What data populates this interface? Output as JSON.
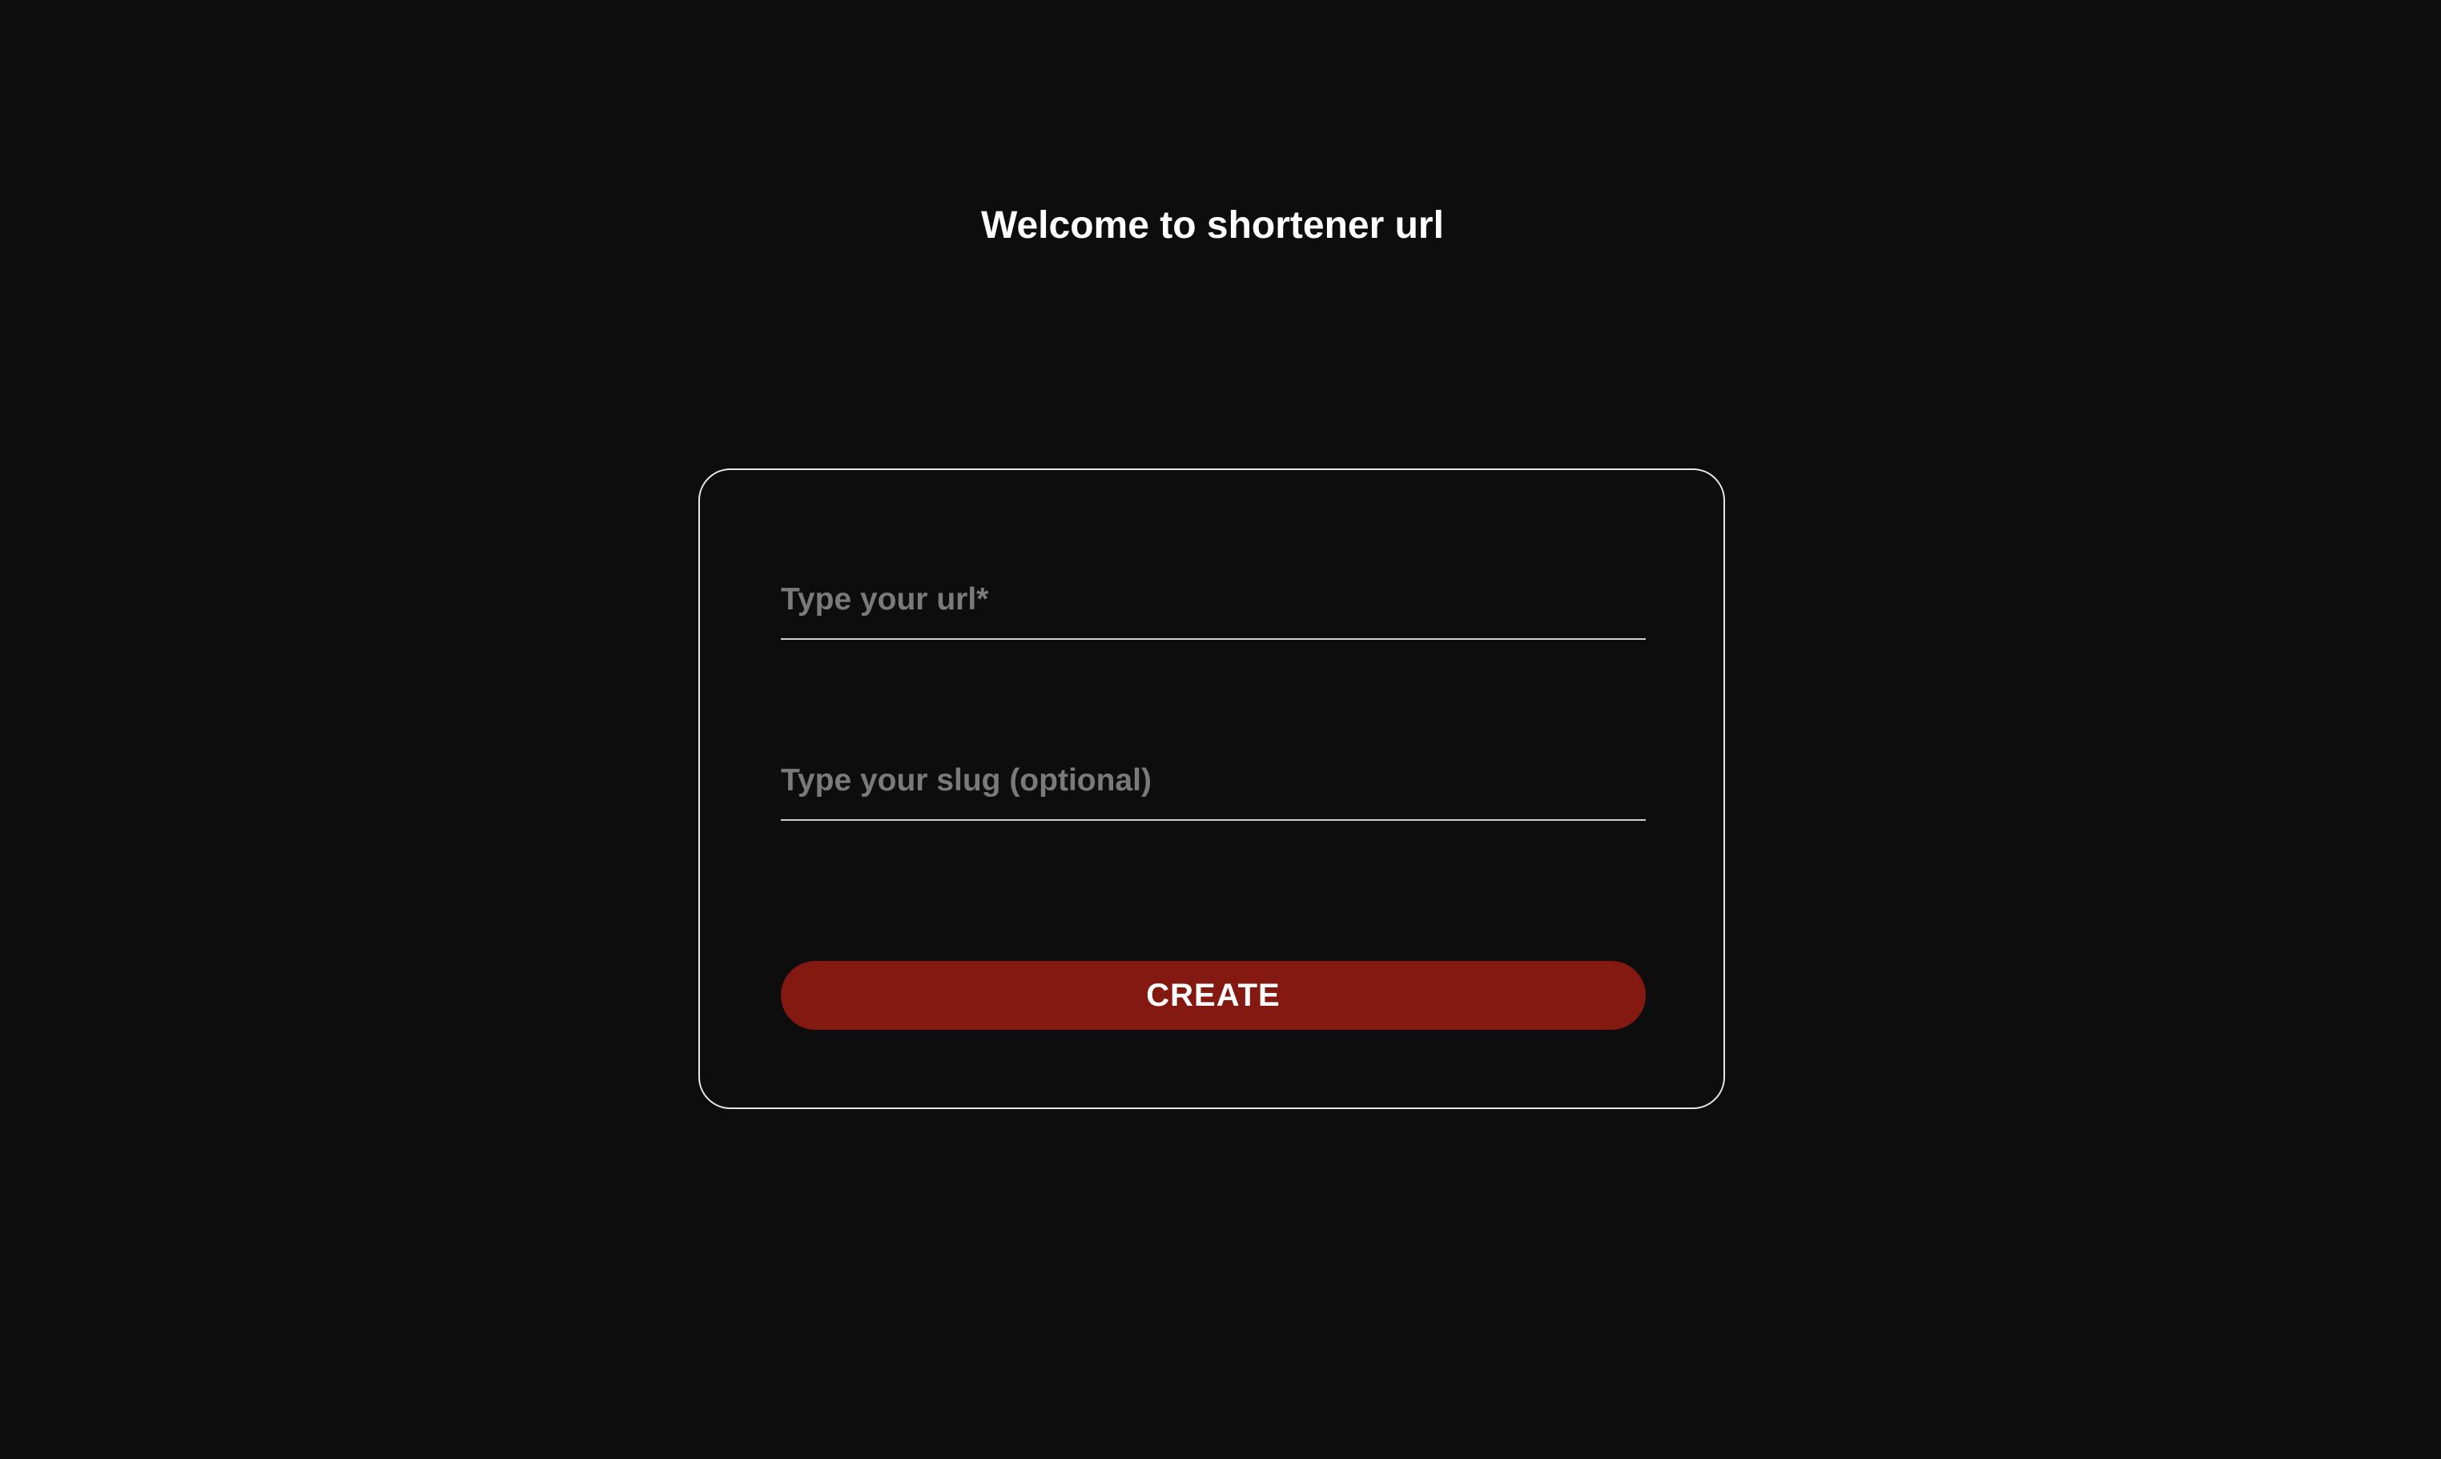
{
  "page": {
    "title": "Welcome to shortener url"
  },
  "form": {
    "url_field": {
      "value": "",
      "placeholder": "Type your url*"
    },
    "slug_field": {
      "value": "",
      "placeholder": "Type your slug (optional)"
    },
    "create_label": "CREATE"
  },
  "colors": {
    "background": "#0d0d0d",
    "card_border": "#e8e8e8",
    "button": "#841911",
    "placeholder": "#7a7a7a",
    "text": "#ffffff"
  }
}
